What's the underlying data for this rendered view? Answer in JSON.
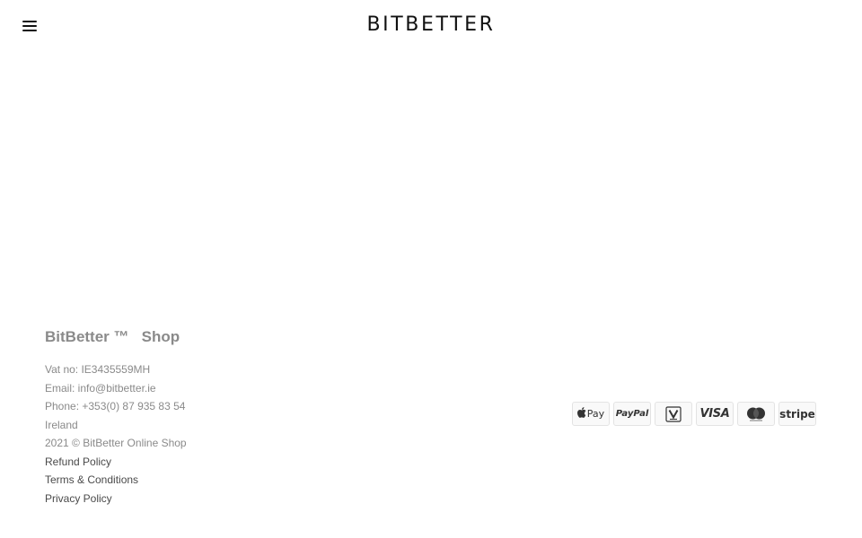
{
  "header": {
    "logo_text": "BITBETTER"
  },
  "footer": {
    "brand": "BitBetter ™   Shop",
    "info": [
      "Vat no: IE3435559MH",
      "Email: info@bitbetter.ie",
      "Phone: +353(0) 87 935 83 54",
      "Ireland",
      "2021 © BitBetter Online Shop"
    ],
    "links": [
      "Refund Policy",
      "Terms & Conditions",
      "Privacy Policy"
    ]
  },
  "payments": {
    "apple_pay": "Pay",
    "paypal": "PayPal",
    "visa": "VISA",
    "stripe": "stripe"
  },
  "colors": {
    "text_muted": "#8a8a8a",
    "link": "#4a4a4a",
    "logo": "#111111",
    "mastercard_circles": "#333333"
  }
}
